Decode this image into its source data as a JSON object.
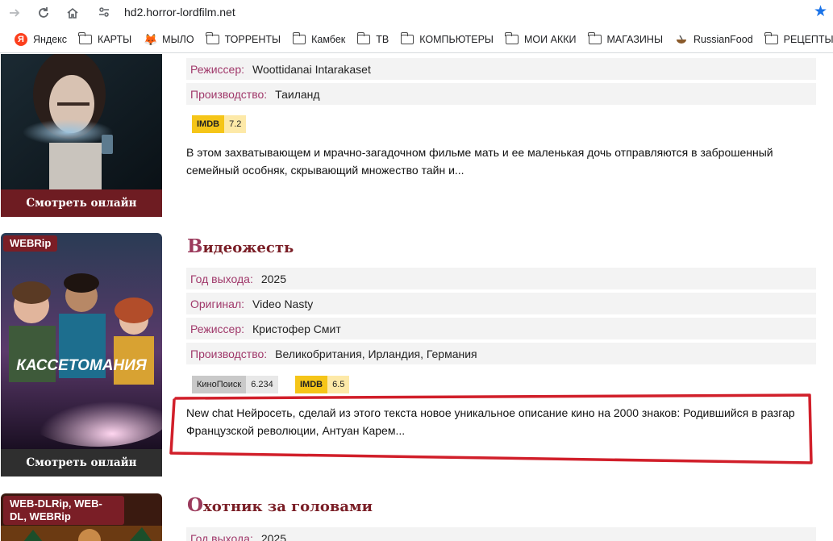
{
  "browser": {
    "url": "hd2.horror-lordfilm.net",
    "bookmarks": [
      {
        "label": "Яндекс",
        "icon": "yandex-icon"
      },
      {
        "label": "КАРТЫ",
        "icon": "folder-icon"
      },
      {
        "label": "МЫЛО",
        "icon": "fox-icon"
      },
      {
        "label": "ТОРРЕНТЫ",
        "icon": "folder-icon"
      },
      {
        "label": "Камбек",
        "icon": "folder-icon"
      },
      {
        "label": "ТВ",
        "icon": "folder-icon"
      },
      {
        "label": "КОМПЬЮТЕРЫ",
        "icon": "folder-icon"
      },
      {
        "label": "МОИ АККИ",
        "icon": "folder-icon"
      },
      {
        "label": "МАГАЗИНЫ",
        "icon": "folder-icon"
      },
      {
        "label": "RussianFood",
        "icon": "bowl-icon"
      },
      {
        "label": "РЕЦЕПТЫ",
        "icon": "folder-icon"
      }
    ]
  },
  "movies": [
    {
      "watch_label": "Смотреть онлайн",
      "fields": [
        {
          "label": "Режиссер:",
          "value": "Woottidanai Intarakaset"
        },
        {
          "label": "Производство:",
          "value": "Таиланд"
        }
      ],
      "ratings": [
        {
          "source": "IMDB",
          "score": "7.2"
        }
      ],
      "description": "В этом захватывающем и мрачно-загадочном фильме мать и ее маленькая дочь отправляются в заброшенный семейный особняк, скрывающий множество тайн и..."
    },
    {
      "quality": "WEBRip",
      "title_cap": "В",
      "title_rest": "идеожесть",
      "poster_text": "КАССЕТОМАНИЯ",
      "watch_label": "Смотреть онлайн",
      "fields": [
        {
          "label": "Год выхода:",
          "value": "2025"
        },
        {
          "label": "Оригинал:",
          "value": "Video Nasty"
        },
        {
          "label": "Режиссер:",
          "value": "Кристофер Смит"
        },
        {
          "label": "Производство:",
          "value": "Великобритания, Ирландия, Германия"
        }
      ],
      "ratings": [
        {
          "source": "КиноПоиск",
          "score": "6.234"
        },
        {
          "source": "IMDB",
          "score": "6.5"
        }
      ],
      "description": "New chat Нейросеть, сделай из этого текста новое уникальное описание кино на 2000 знаков: Родившийся в разгар Французской революции, Антуан Карем..."
    },
    {
      "quality": "WEB-DLRip, WEB-DL, WEBRip",
      "title_cap": "О",
      "title_rest": "хотник за головами",
      "fields": [
        {
          "label": "Год выхода:",
          "value": "2025"
        }
      ]
    }
  ],
  "colors": {
    "accent": "#7a1e26",
    "label": "#a0386a",
    "annotation": "#d11f2a",
    "star": "#1a73e8"
  }
}
